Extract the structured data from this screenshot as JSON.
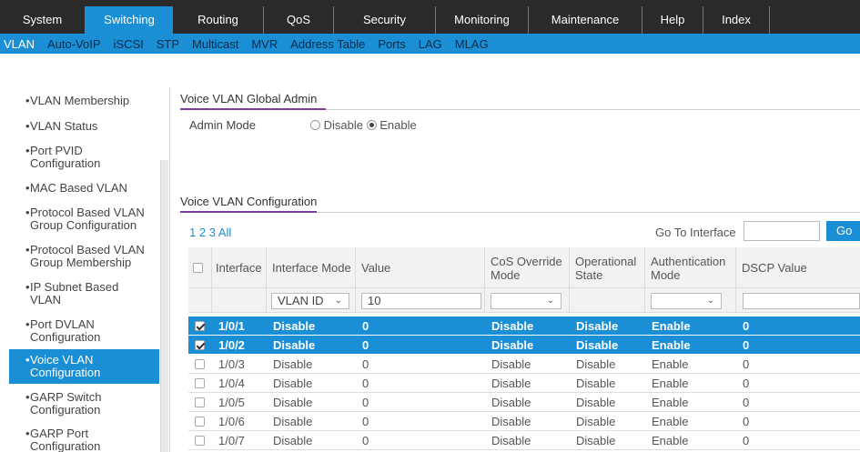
{
  "topnav": {
    "tabs": [
      {
        "label": "System",
        "active": false
      },
      {
        "label": "Switching",
        "active": true
      },
      {
        "label": "Routing",
        "active": false
      },
      {
        "label": "QoS",
        "active": false
      },
      {
        "label": "Security",
        "active": false
      },
      {
        "label": "Monitoring",
        "active": false
      },
      {
        "label": "Maintenance",
        "active": false
      },
      {
        "label": "Help",
        "active": false
      },
      {
        "label": "Index",
        "active": false
      }
    ]
  },
  "subnav": {
    "items": [
      {
        "label": "VLAN",
        "active": true
      },
      {
        "label": "Auto-VoIP",
        "active": false
      },
      {
        "label": "iSCSI",
        "active": false
      },
      {
        "label": "STP",
        "active": false
      },
      {
        "label": "Multicast",
        "active": false
      },
      {
        "label": "MVR",
        "active": false
      },
      {
        "label": "Address Table",
        "active": false
      },
      {
        "label": "Ports",
        "active": false
      },
      {
        "label": "LAG",
        "active": false
      },
      {
        "label": "MLAG",
        "active": false
      }
    ]
  },
  "sidebar": {
    "items": [
      {
        "label": "VLAN Membership",
        "active": false
      },
      {
        "label": "VLAN Status",
        "active": false
      },
      {
        "label": "Port PVID Configuration",
        "active": false
      },
      {
        "label": "MAC Based VLAN",
        "active": false
      },
      {
        "label": "Protocol Based VLAN Group Configuration",
        "active": false
      },
      {
        "label": "Protocol Based VLAN Group Membership",
        "active": false
      },
      {
        "label": "IP Subnet Based VLAN",
        "active": false
      },
      {
        "label": "Port DVLAN Configuration",
        "active": false
      },
      {
        "label": "Voice VLAN Configuration",
        "active": true
      },
      {
        "label": "GARP Switch Configuration",
        "active": false
      },
      {
        "label": "GARP Port Configuration",
        "active": false
      }
    ]
  },
  "global": {
    "title": "Voice VLAN Global Admin",
    "admin_mode_label": "Admin Mode",
    "disable_label": "Disable",
    "enable_label": "Enable",
    "selected": "Enable"
  },
  "config": {
    "title": "Voice VLAN Configuration",
    "pages": [
      "1",
      "2",
      "3",
      "All"
    ],
    "goto_label": "Go To Interface",
    "goto_value": "",
    "go_button": "Go",
    "columns": [
      "",
      "Interface",
      "Interface Mode",
      "Value",
      "CoS Override Mode",
      "Operational State",
      "Authentication Mode",
      "DSCP Value"
    ],
    "filter": {
      "interface_mode": "VLAN ID",
      "value": "10",
      "cos_override": "",
      "authentication": "",
      "dscp": ""
    },
    "rows": [
      {
        "checked": true,
        "selected": true,
        "interface": "1/0/1",
        "mode": "Disable",
        "value": "0",
        "cos": "Disable",
        "oper": "Disable",
        "auth": "Enable",
        "dscp": "0"
      },
      {
        "checked": true,
        "selected": true,
        "interface": "1/0/2",
        "mode": "Disable",
        "value": "0",
        "cos": "Disable",
        "oper": "Disable",
        "auth": "Enable",
        "dscp": "0"
      },
      {
        "checked": false,
        "selected": false,
        "interface": "1/0/3",
        "mode": "Disable",
        "value": "0",
        "cos": "Disable",
        "oper": "Disable",
        "auth": "Enable",
        "dscp": "0"
      },
      {
        "checked": false,
        "selected": false,
        "interface": "1/0/4",
        "mode": "Disable",
        "value": "0",
        "cos": "Disable",
        "oper": "Disable",
        "auth": "Enable",
        "dscp": "0"
      },
      {
        "checked": false,
        "selected": false,
        "interface": "1/0/5",
        "mode": "Disable",
        "value": "0",
        "cos": "Disable",
        "oper": "Disable",
        "auth": "Enable",
        "dscp": "0"
      },
      {
        "checked": false,
        "selected": false,
        "interface": "1/0/6",
        "mode": "Disable",
        "value": "0",
        "cos": "Disable",
        "oper": "Disable",
        "auth": "Enable",
        "dscp": "0"
      },
      {
        "checked": false,
        "selected": false,
        "interface": "1/0/7",
        "mode": "Disable",
        "value": "0",
        "cos": "Disable",
        "oper": "Disable",
        "auth": "Enable",
        "dscp": "0"
      }
    ]
  },
  "colors": {
    "accent": "#1a8fd6",
    "topbar": "#2a2a2a",
    "section_underline": "#7b3f98"
  }
}
